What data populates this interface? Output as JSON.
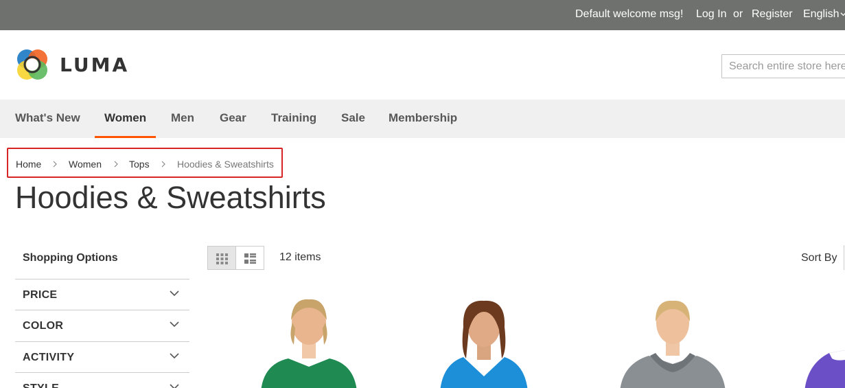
{
  "topbar": {
    "welcome": "Default welcome msg!",
    "login": "Log In",
    "or": "or",
    "register": "Register",
    "language": "English"
  },
  "header": {
    "logo_text": "LUMA",
    "search_placeholder": "Search entire store here..."
  },
  "nav": {
    "items": [
      {
        "label": "What's New",
        "active": false
      },
      {
        "label": "Women",
        "active": true
      },
      {
        "label": "Men",
        "active": false
      },
      {
        "label": "Gear",
        "active": false
      },
      {
        "label": "Training",
        "active": false
      },
      {
        "label": "Sale",
        "active": false
      },
      {
        "label": "Membership",
        "active": false
      }
    ]
  },
  "breadcrumb": {
    "items": [
      "Home",
      "Women",
      "Tops",
      "Hoodies & Sweatshirts"
    ]
  },
  "page_title": "Hoodies & Sweatshirts",
  "sidebar": {
    "title": "Shopping Options",
    "filters": [
      "PRICE",
      "COLOR",
      "ACTIVITY",
      "STYLE"
    ]
  },
  "toolbar": {
    "amount": "12 items",
    "sort_label": "Sort By",
    "grid_icon": "grid-icon",
    "list_icon": "list-icon"
  },
  "products": [
    {
      "shirt_color": "#1f8a52"
    },
    {
      "shirt_color": "#1c8fd8"
    },
    {
      "shirt_color": "#8a8f94"
    },
    {
      "shirt_color": "#6a4fc7"
    }
  ],
  "colors": {
    "topbar_bg": "#6e716e",
    "nav_active_underline": "#ff5501",
    "breadcrumb_highlight": "#d62323"
  }
}
